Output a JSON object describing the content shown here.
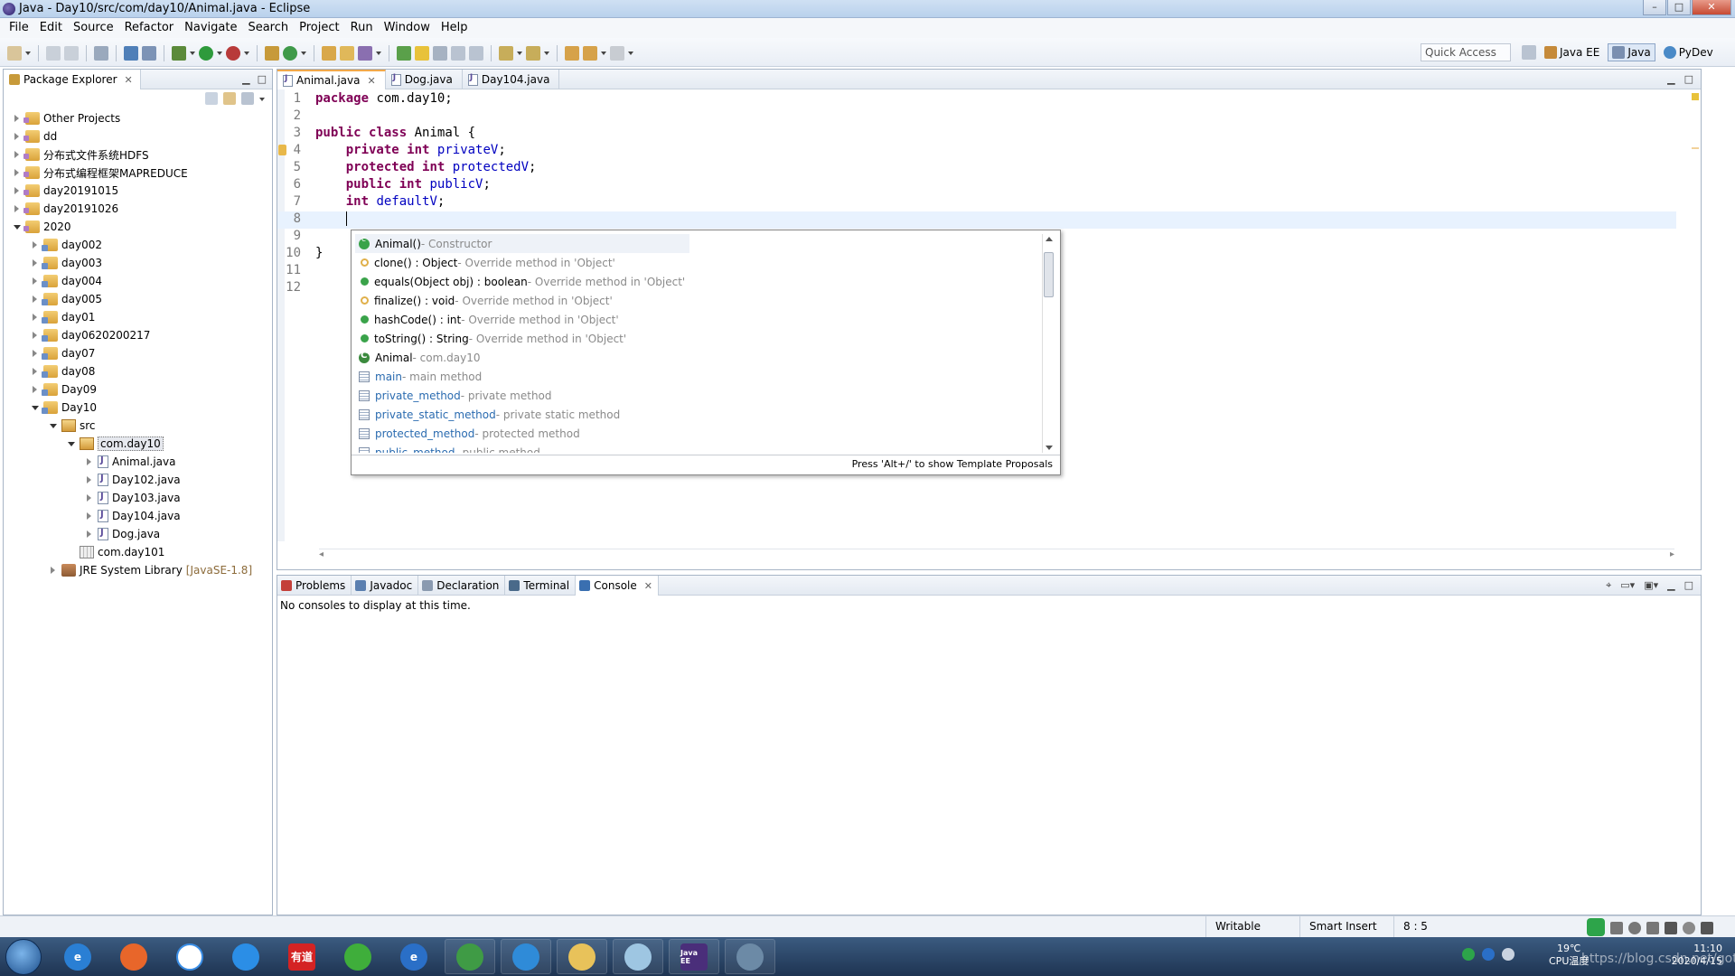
{
  "window": {
    "title": "Java - Day10/src/com/day10/Animal.java - Eclipse",
    "min_label": "–",
    "max_label": "□",
    "close_label": "✕"
  },
  "menu": [
    "File",
    "Edit",
    "Source",
    "Refactor",
    "Navigate",
    "Search",
    "Project",
    "Run",
    "Window",
    "Help"
  ],
  "toolbar": {
    "quick_access_placeholder": "Quick Access",
    "perspectives": [
      "Java EE",
      "Java",
      "PyDev"
    ],
    "active_perspective": "Java"
  },
  "package_explorer": {
    "title": "Package Explorer",
    "close_label": "✕",
    "tree": [
      {
        "label": "Other Projects",
        "depth": 0,
        "state": "closed",
        "icon": "project-set-icon"
      },
      {
        "label": "dd",
        "depth": 0,
        "state": "closed",
        "icon": "project-icon"
      },
      {
        "label": "分布式文件系统HDFS",
        "depth": 0,
        "state": "closed",
        "icon": "project-icon"
      },
      {
        "label": "分布式编程框架MAPREDUCE",
        "depth": 0,
        "state": "closed",
        "icon": "project-icon"
      },
      {
        "label": "day20191015",
        "depth": 0,
        "state": "closed",
        "icon": "project-icon"
      },
      {
        "label": "day20191026",
        "depth": 0,
        "state": "closed",
        "icon": "project-icon"
      },
      {
        "label": "2020",
        "depth": 0,
        "state": "open",
        "icon": "project-icon"
      },
      {
        "label": "day002",
        "depth": 1,
        "state": "closed",
        "icon": "java-project-icon"
      },
      {
        "label": "day003",
        "depth": 1,
        "state": "closed",
        "icon": "java-project-icon"
      },
      {
        "label": "day004",
        "depth": 1,
        "state": "closed",
        "icon": "java-project-icon"
      },
      {
        "label": "day005",
        "depth": 1,
        "state": "closed",
        "icon": "java-project-icon"
      },
      {
        "label": "day01",
        "depth": 1,
        "state": "closed",
        "icon": "java-project-icon"
      },
      {
        "label": "day0620200217",
        "depth": 1,
        "state": "closed",
        "icon": "java-project-icon"
      },
      {
        "label": "day07",
        "depth": 1,
        "state": "closed",
        "icon": "java-project-icon"
      },
      {
        "label": "day08",
        "depth": 1,
        "state": "closed",
        "icon": "java-project-icon"
      },
      {
        "label": "Day09",
        "depth": 1,
        "state": "closed",
        "icon": "java-project-icon"
      },
      {
        "label": "Day10",
        "depth": 1,
        "state": "open",
        "icon": "java-project-icon"
      },
      {
        "label": "src",
        "depth": 2,
        "state": "open",
        "icon": "source-folder-icon"
      },
      {
        "label": "com.day10",
        "depth": 3,
        "state": "open",
        "icon": "package-icon",
        "selected": true
      },
      {
        "label": "Animal.java",
        "depth": 4,
        "state": "closed",
        "icon": "java-file-icon"
      },
      {
        "label": "Day102.java",
        "depth": 4,
        "state": "closed",
        "icon": "java-file-icon"
      },
      {
        "label": "Day103.java",
        "depth": 4,
        "state": "closed",
        "icon": "java-file-icon"
      },
      {
        "label": "Day104.java",
        "depth": 4,
        "state": "closed",
        "icon": "java-file-icon"
      },
      {
        "label": "Dog.java",
        "depth": 4,
        "state": "closed",
        "icon": "java-file-icon"
      },
      {
        "label": "com.day101",
        "depth": 3,
        "state": "none",
        "icon": "empty-package-icon"
      },
      {
        "label": "JRE System Library",
        "suffix": "[JavaSE-1.8]",
        "depth": 2,
        "state": "closed",
        "icon": "library-icon"
      }
    ]
  },
  "editor": {
    "tabs": [
      {
        "label": "Animal.java",
        "active": true,
        "close": "✕"
      },
      {
        "label": "Dog.java",
        "active": false,
        "close": ""
      },
      {
        "label": "Day104.java",
        "active": false,
        "close": ""
      }
    ],
    "lines": [
      {
        "n": "1",
        "tokens": [
          {
            "t": "package",
            "c": "kw"
          },
          {
            "t": " com.day10;",
            "c": ""
          }
        ]
      },
      {
        "n": "2",
        "tokens": []
      },
      {
        "n": "3",
        "tokens": [
          {
            "t": "public",
            "c": "kw"
          },
          {
            "t": " ",
            "c": ""
          },
          {
            "t": "class",
            "c": "kw"
          },
          {
            "t": " Animal {",
            "c": ""
          }
        ]
      },
      {
        "n": "4",
        "tokens": [
          {
            "t": "    ",
            "c": ""
          },
          {
            "t": "private",
            "c": "kw"
          },
          {
            "t": " ",
            "c": ""
          },
          {
            "t": "int",
            "c": "kw"
          },
          {
            "t": " ",
            "c": ""
          },
          {
            "t": "privateV",
            "c": "fld"
          },
          {
            "t": ";",
            "c": ""
          }
        ]
      },
      {
        "n": "5",
        "tokens": [
          {
            "t": "    ",
            "c": ""
          },
          {
            "t": "protected",
            "c": "kw"
          },
          {
            "t": " ",
            "c": ""
          },
          {
            "t": "int",
            "c": "kw"
          },
          {
            "t": " ",
            "c": ""
          },
          {
            "t": "protectedV",
            "c": "fld"
          },
          {
            "t": ";",
            "c": ""
          }
        ]
      },
      {
        "n": "6",
        "tokens": [
          {
            "t": "    ",
            "c": ""
          },
          {
            "t": "public",
            "c": "kw"
          },
          {
            "t": " ",
            "c": ""
          },
          {
            "t": "int",
            "c": "kw"
          },
          {
            "t": " ",
            "c": ""
          },
          {
            "t": "publicV",
            "c": "fld"
          },
          {
            "t": ";",
            "c": ""
          }
        ]
      },
      {
        "n": "7",
        "tokens": [
          {
            "t": "    ",
            "c": ""
          },
          {
            "t": "int",
            "c": "kw"
          },
          {
            "t": " ",
            "c": ""
          },
          {
            "t": "defaultV",
            "c": "fld"
          },
          {
            "t": ";",
            "c": ""
          }
        ]
      },
      {
        "n": "8",
        "tokens": [
          {
            "t": "    ",
            "c": ""
          }
        ],
        "caret": true,
        "current": true
      },
      {
        "n": "9",
        "tokens": []
      },
      {
        "n": "10",
        "tokens": [
          {
            "t": "}",
            "c": ""
          }
        ]
      },
      {
        "n": "11",
        "tokens": []
      },
      {
        "n": "12",
        "tokens": []
      }
    ]
  },
  "completion": {
    "items": [
      {
        "name": "Animal()",
        "desc": " - Constructor",
        "icon": "constructor-icon",
        "link": false,
        "selected": true
      },
      {
        "name": "clone() : Object",
        "desc": " - Override method in 'Object'",
        "icon": "protected-method-icon",
        "link": false
      },
      {
        "name": "equals(Object obj) : boolean",
        "desc": " - Override method in 'Object'",
        "icon": "public-method-icon",
        "link": false
      },
      {
        "name": "finalize() : void",
        "desc": " - Override method in 'Object'",
        "icon": "protected-method-icon",
        "link": false
      },
      {
        "name": "hashCode() : int",
        "desc": " - Override method in 'Object'",
        "icon": "public-method-icon",
        "link": false
      },
      {
        "name": "toString() : String",
        "desc": " - Override method in 'Object'",
        "icon": "public-method-icon",
        "link": false
      },
      {
        "name": "Animal",
        "desc": " - com.day10",
        "icon": "class-icon",
        "link": false
      },
      {
        "name": "main",
        "desc": " - main method",
        "icon": "template-icon",
        "link": true
      },
      {
        "name": "private_method",
        "desc": " - private method",
        "icon": "template-icon",
        "link": true
      },
      {
        "name": "private_static_method",
        "desc": " - private static method",
        "icon": "template-icon",
        "link": true
      },
      {
        "name": "protected_method",
        "desc": " - protected method",
        "icon": "template-icon",
        "link": true
      },
      {
        "name": "public_method",
        "desc": " - public method",
        "icon": "template-icon",
        "link": true
      }
    ],
    "footer": "Press 'Alt+/' to show Template Proposals"
  },
  "bottom_panel": {
    "tabs": [
      {
        "label": "Problems",
        "active": false,
        "icon": "problems-icon"
      },
      {
        "label": "Javadoc",
        "active": false,
        "icon": "javadoc-icon"
      },
      {
        "label": "Declaration",
        "active": false,
        "icon": "declaration-icon"
      },
      {
        "label": "Terminal",
        "active": false,
        "icon": "terminal-icon"
      },
      {
        "label": "Console",
        "active": true,
        "icon": "console-icon",
        "close": "✕"
      }
    ],
    "message": "No consoles to display at this time."
  },
  "status": {
    "writable": "Writable",
    "insert_mode": "Smart Insert",
    "position": "8 : 5"
  },
  "taskbar": {
    "apps": [
      {
        "name": "internet-explorer",
        "label": "e",
        "color": "#2a7fd4"
      },
      {
        "name": "firefox",
        "label": "",
        "color": "#e8662a"
      },
      {
        "name": "baidu-netdisk",
        "label": "",
        "color": "#ffffff"
      },
      {
        "name": "cloud-app",
        "label": "",
        "color": "#2b8ee6"
      },
      {
        "name": "youdao",
        "label": "有道",
        "color": "#d42323"
      },
      {
        "name": "app-green",
        "label": "",
        "color": "#3fae3b"
      },
      {
        "name": "browser-e",
        "label": "e",
        "color": "#2a6fc7"
      },
      {
        "name": "chrome",
        "label": "",
        "color": "#3f9b45"
      },
      {
        "name": "app-blue",
        "label": "",
        "color": "#2f8bd8"
      },
      {
        "name": "file-explorer",
        "label": "",
        "color": "#e8c25a"
      },
      {
        "name": "notepad",
        "label": "",
        "color": "#9ec6e2"
      },
      {
        "name": "eclipse-javaee",
        "label": "Java EE",
        "color": "#4a2e7a"
      },
      {
        "name": "app-game",
        "label": "",
        "color": "#6c8aa6"
      }
    ],
    "temperature": "19℃",
    "cpu_label": "CPU温度",
    "time": "11:10",
    "date": "2020/4/15",
    "watermark": "https://blog.csdn.net/gotoiako"
  }
}
